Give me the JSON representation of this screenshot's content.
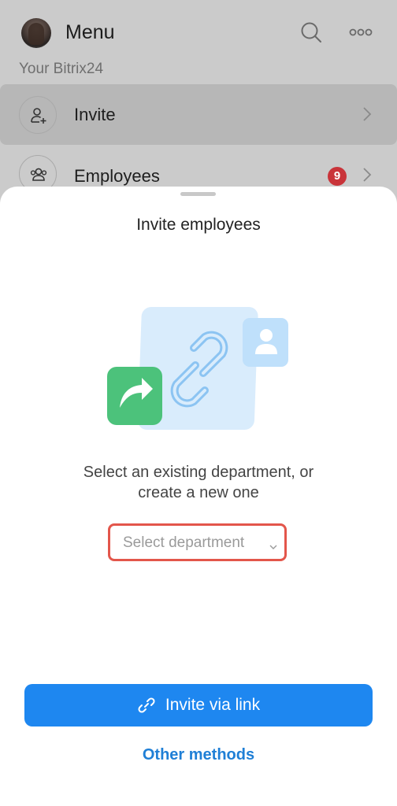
{
  "header": {
    "title": "Menu",
    "portal_name": "Your Bitrix24"
  },
  "menu": {
    "items": [
      {
        "label": "Invite",
        "icon": "add-user-icon"
      },
      {
        "label": "Employees",
        "icon": "people-icon",
        "badge": "9"
      }
    ]
  },
  "sheet": {
    "title": "Invite employees",
    "prompt_line1": "Select an existing department, or",
    "prompt_line2": "create a new one",
    "department_select": {
      "placeholder": "Select department"
    },
    "primary_button": "Invite via link",
    "secondary_link": "Other methods"
  },
  "colors": {
    "accent": "#1e87f0",
    "link": "#1f7fd6",
    "highlight_border": "#e3564b",
    "badge": "#c9343a",
    "share_green": "#4cc27b",
    "illustration_blue": "#d9ecfc"
  }
}
